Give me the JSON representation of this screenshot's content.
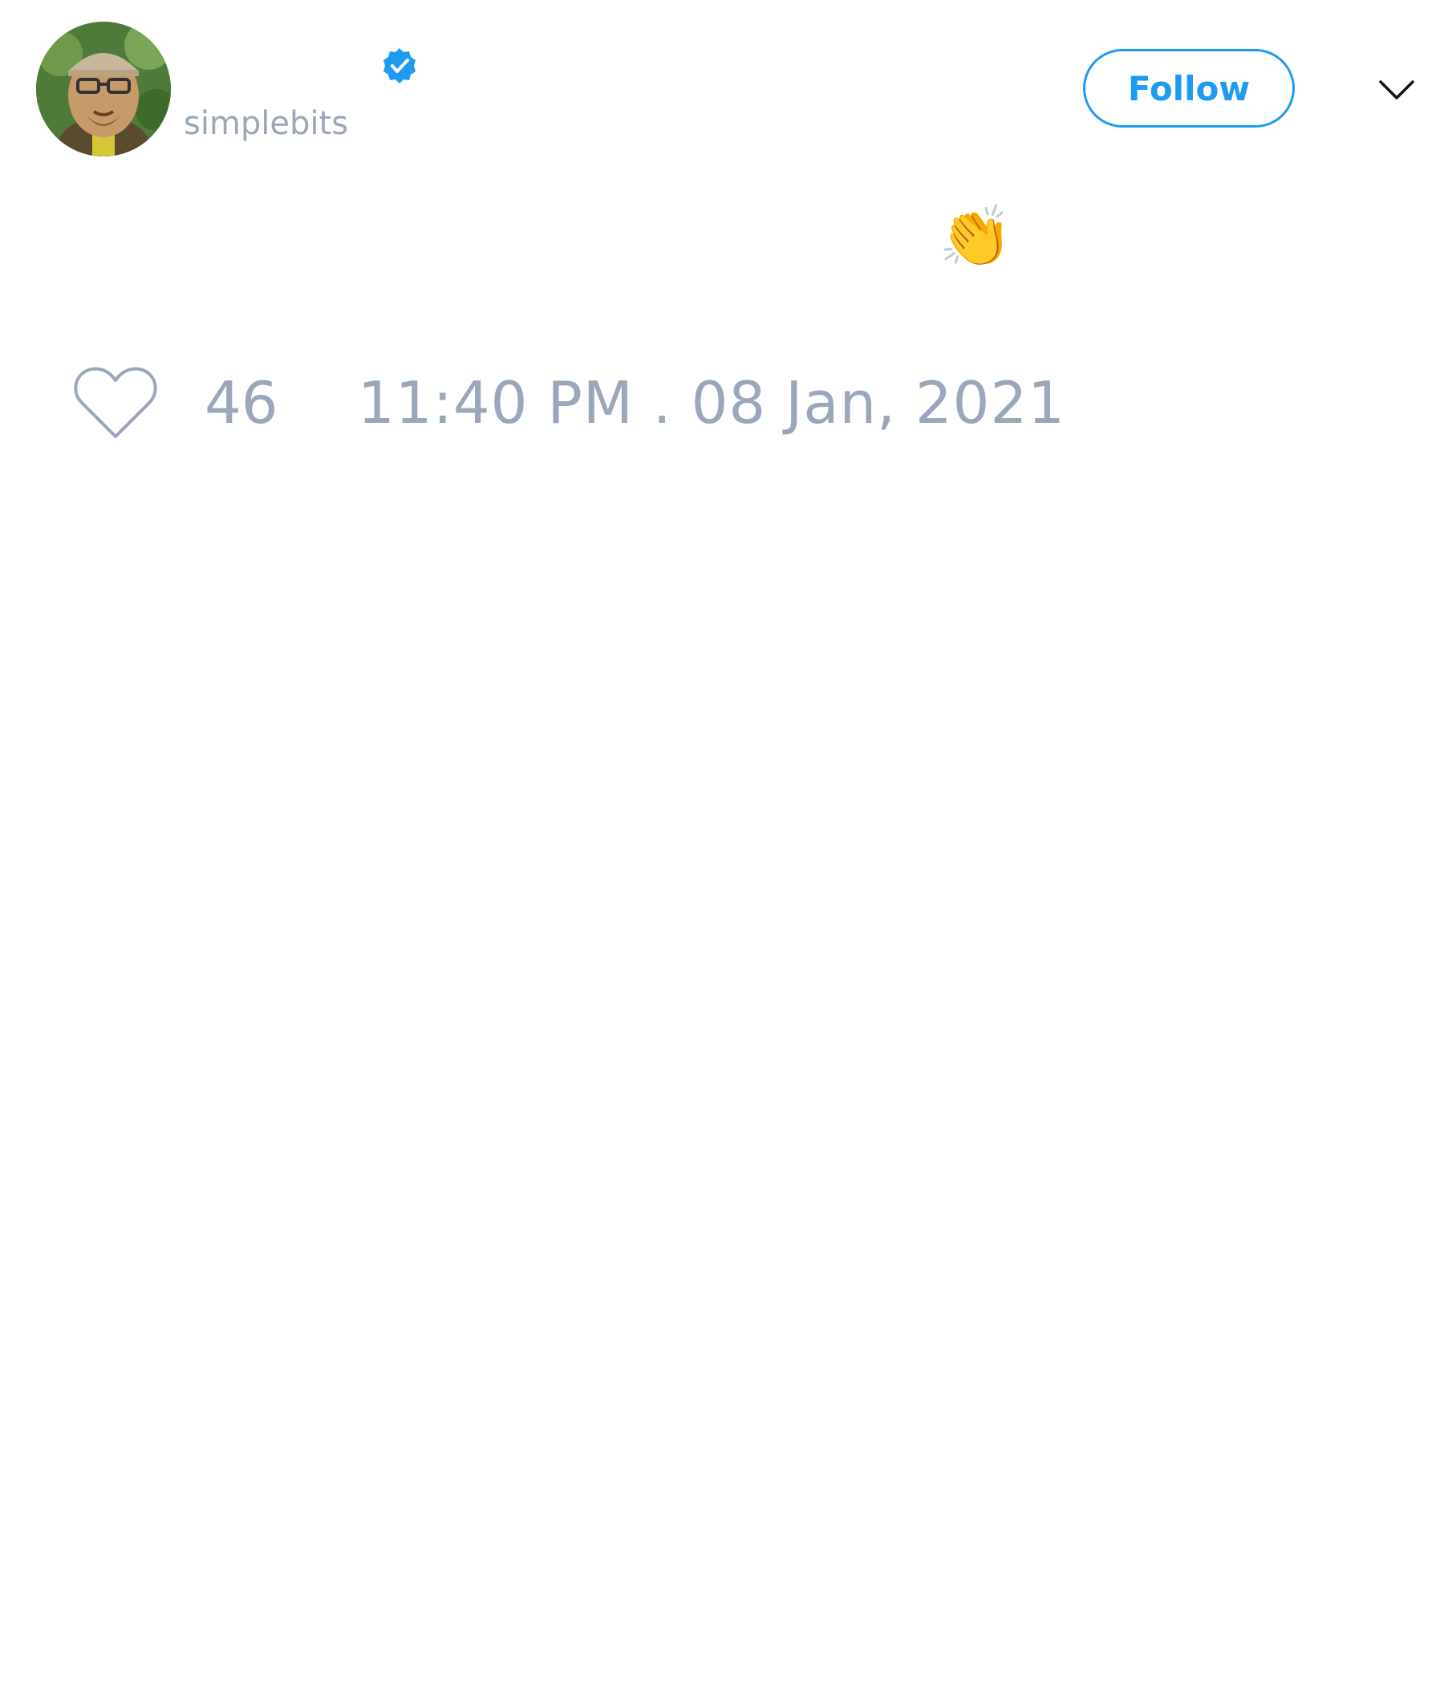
{
  "author": {
    "display_name": "",
    "handle": "simplebits",
    "verified": true,
    "avatar_icon": "avatar-photo"
  },
  "actions": {
    "follow_label": "Follow",
    "menu_icon": "chevron-down-icon"
  },
  "tweet": {
    "text": "👏"
  },
  "stats": {
    "like_icon": "heart-icon",
    "likes": "46",
    "timestamp": "11:40 PM . 08 Jan, 2021"
  },
  "colors": {
    "accent": "#1d9bf0",
    "muted_text": "#9aa6b9",
    "background": "#ffffff"
  }
}
